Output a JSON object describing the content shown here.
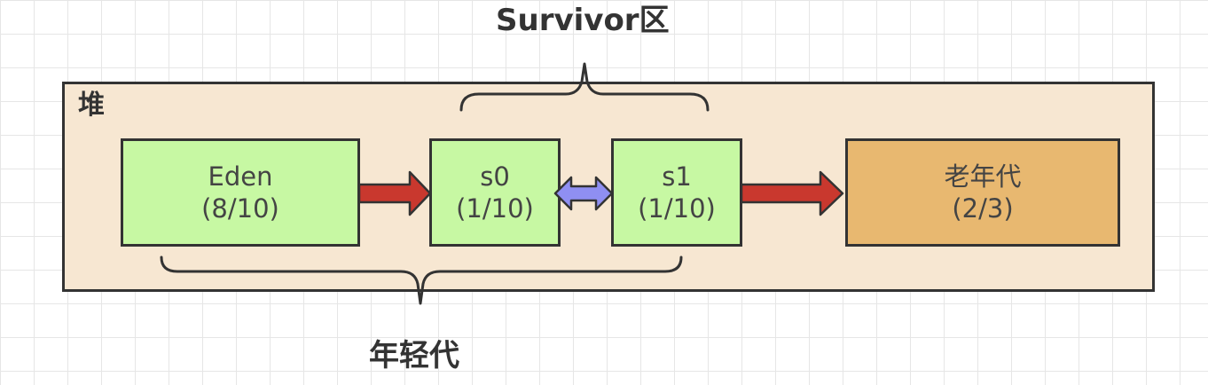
{
  "survivor_label": "Survivor区",
  "heap_label": "堆",
  "young_gen_label": "年轻代",
  "eden": {
    "name": "Eden",
    "ratio": "(8/10)"
  },
  "s0": {
    "name": "s0",
    "ratio": "(1/10)"
  },
  "s1": {
    "name": "s1",
    "ratio": "(1/10)"
  },
  "old_gen": {
    "name": "老年代",
    "ratio": "(2/3)"
  },
  "colors": {
    "young_box": "#c7f8a3",
    "old_box": "#e8b870",
    "heap_bg": "#f7e7d2",
    "promote_arrow": "#c9382e",
    "swap_arrow": "#8f8ff2"
  }
}
